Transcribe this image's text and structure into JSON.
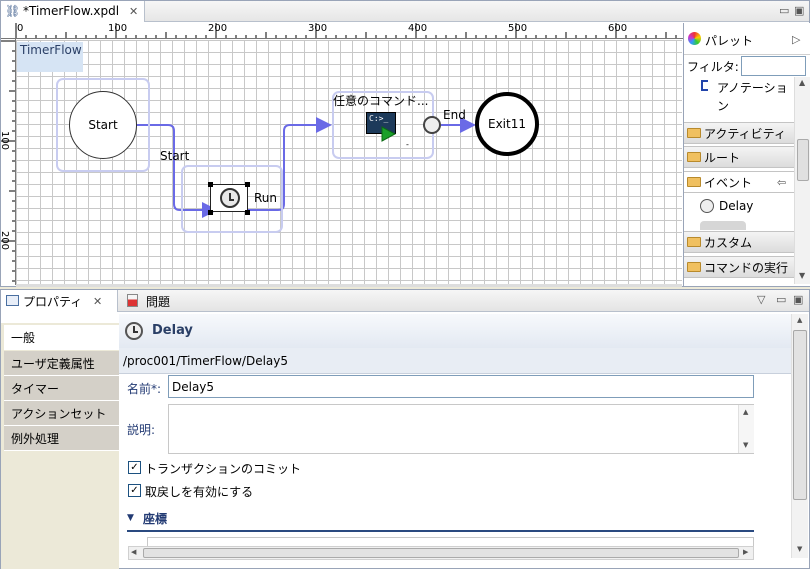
{
  "editor": {
    "tab_title": "*TimerFlow.xpdl",
    "ruler_top": [
      "0",
      "100",
      "200",
      "300",
      "400",
      "500",
      "600"
    ],
    "ruler_left": [
      "100",
      "200"
    ],
    "pool_label": "TimerFlow",
    "nodes": {
      "start": "Start",
      "exit": "Exit11",
      "command_label": "任意のコマンド...",
      "command_icon_text": "C:>_"
    },
    "flows": {
      "start_flow": "Start",
      "run_flow": "Run",
      "end_flow": "End"
    }
  },
  "palette": {
    "title": "パレット",
    "filter_label": "フィルタ:",
    "filter_value": "",
    "annotation": "アノテーション",
    "drawers": [
      "アクティビティ",
      "ルート",
      "イベント",
      "カスタム",
      "コマンドの実行"
    ],
    "event_item": "Delay"
  },
  "properties": {
    "tab_properties": "プロパティ",
    "tab_problems": "問題",
    "side_items": [
      "一般",
      "ユーザ定義属性",
      "タイマー",
      "アクションセット",
      "例外処理"
    ],
    "title": "Delay",
    "path": "/proc001/TimerFlow/Delay5",
    "name_label": "名前*:",
    "name_value": "Delay5",
    "desc_label": "説明:",
    "desc_value": "",
    "commit_label": "トランザクションのコミット",
    "commit_checked": "✓",
    "undo_label": "取戻しを有効にする",
    "undo_checked": "✓",
    "section_coords": "座標"
  },
  "colors": {
    "flow_line": "#6a6ae6",
    "selection": "#c8ccf0",
    "label_blue": "#223a73",
    "title_blue": "#2a3f66"
  }
}
